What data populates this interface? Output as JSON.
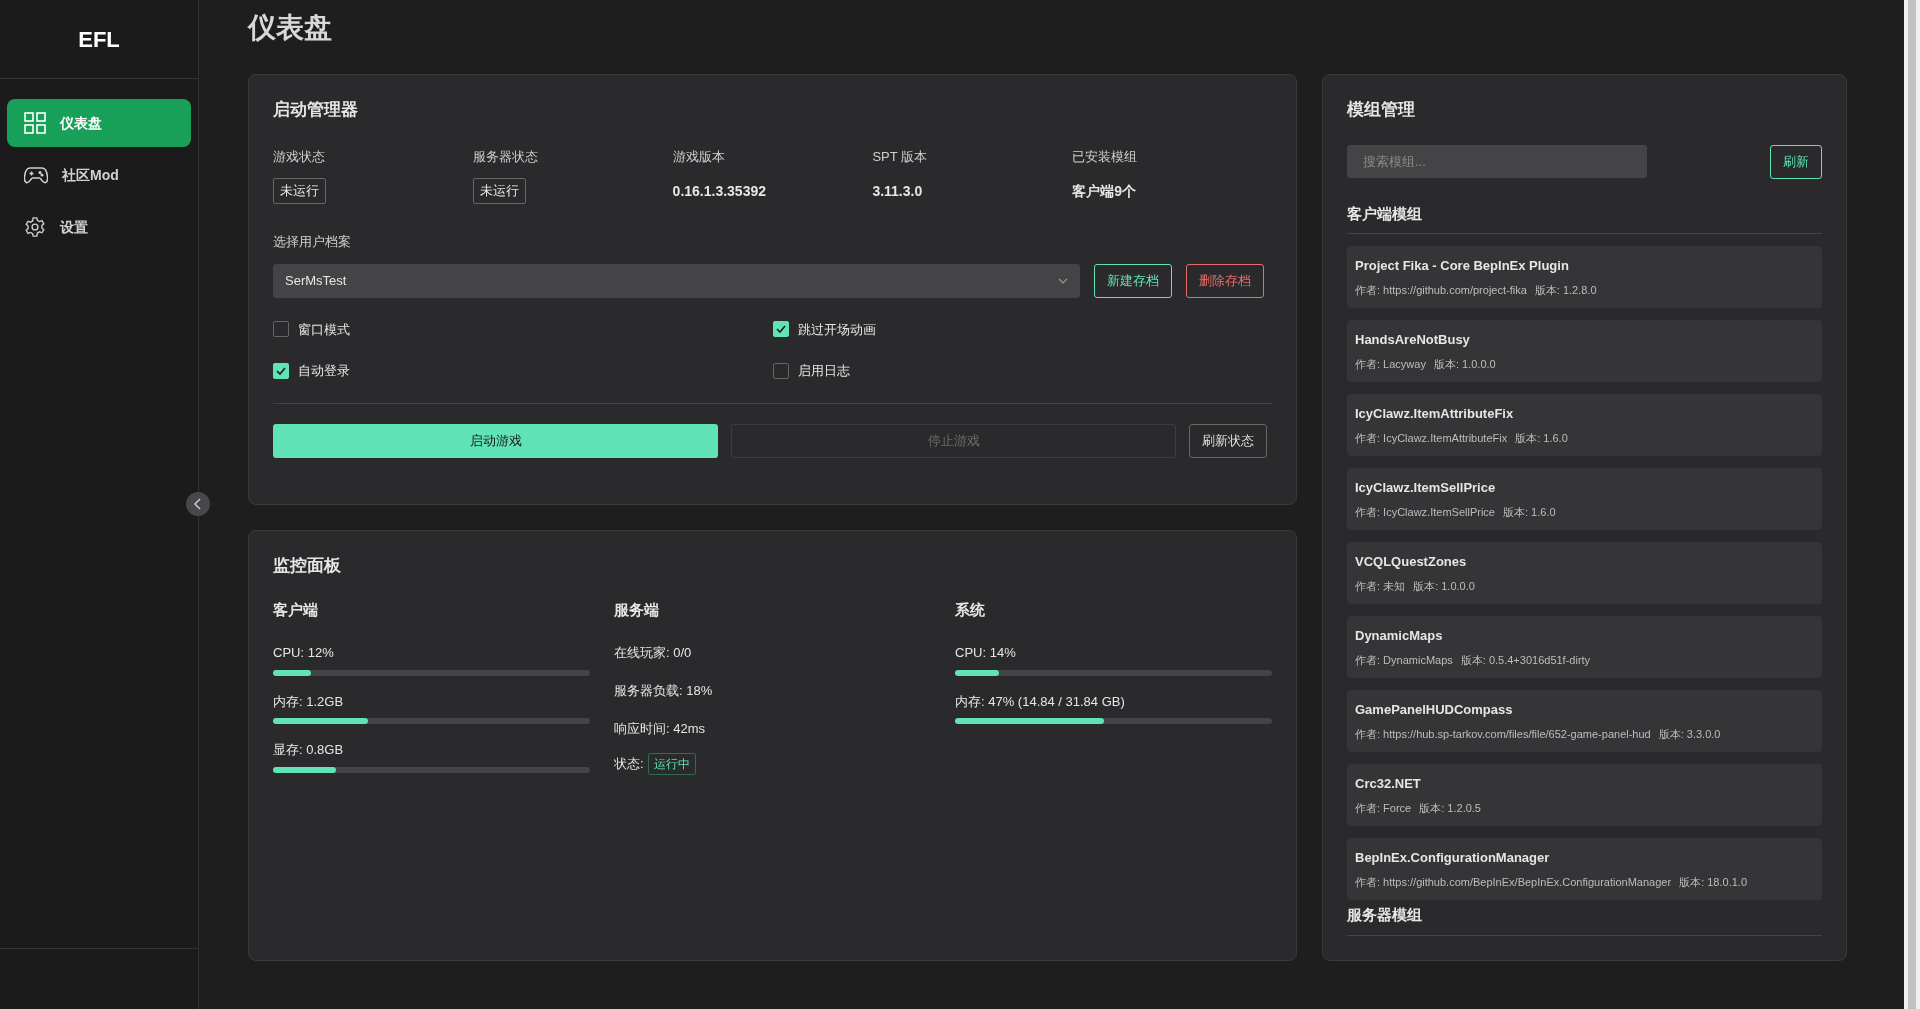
{
  "sidebar": {
    "logo": "EFL",
    "nav_items": [
      {
        "label": "仪表盘",
        "selected": true
      },
      {
        "label": "社区Mod",
        "selected": false
      },
      {
        "label": "设置",
        "selected": false
      }
    ]
  },
  "page_title": "仪表盘",
  "launcher": {
    "title": "启动管理器",
    "status": [
      {
        "label": "游戏状态",
        "value": "未运行",
        "kind": "badge"
      },
      {
        "label": "服务器状态",
        "value": "未运行",
        "kind": "badge"
      },
      {
        "label": "游戏版本",
        "value": "0.16.1.3.35392",
        "kind": "text"
      },
      {
        "label": "SPT 版本",
        "value": "3.11.3.0",
        "kind": "text"
      },
      {
        "label": "已安装模组",
        "value": "客户端9个",
        "kind": "text"
      }
    ],
    "profile": {
      "label": "选择用户档案",
      "value": "SerMsTest"
    },
    "profile_buttons": [
      {
        "label": "新建存档",
        "kind": "success"
      },
      {
        "label": "删除存档",
        "kind": "danger"
      }
    ],
    "options": [
      {
        "label": "窗口模式",
        "checked": false
      },
      {
        "label": "跳过开场动画",
        "checked": true
      },
      {
        "label": "自动登录",
        "checked": true
      },
      {
        "label": "启用日志",
        "checked": false
      }
    ],
    "actions": [
      {
        "label": "启动游戏",
        "kind": "primary",
        "disabled": false
      },
      {
        "label": "停止游戏",
        "kind": "outline",
        "disabled": true
      },
      {
        "label": "刷新状态",
        "kind": "outline",
        "disabled": false
      }
    ]
  },
  "monitor": {
    "title": "监控面板",
    "columns": [
      {
        "title": "客户端",
        "rows": [
          {
            "kind": "meter",
            "label": "CPU: 12%",
            "level": 0.12
          },
          {
            "kind": "meter",
            "label": "内存: 1.2GB",
            "level": 0.3
          },
          {
            "kind": "meter",
            "label": "显存: 0.8GB",
            "level": 0.2
          }
        ]
      },
      {
        "title": "服务端",
        "rows": [
          {
            "kind": "text",
            "label": "在线玩家: 0/0"
          },
          {
            "kind": "text",
            "label": "服务器负载: 18%"
          },
          {
            "kind": "text",
            "label": "响应时间: 42ms"
          },
          {
            "kind": "status",
            "label": "状态:",
            "badge": "运行中"
          }
        ]
      },
      {
        "title": "系统",
        "rows": [
          {
            "kind": "meter",
            "label": "CPU: 14%",
            "level": 0.14
          },
          {
            "kind": "meter",
            "label": "内存: 47% (14.84 / 31.84 GB)",
            "level": 0.47
          }
        ]
      }
    ]
  },
  "mods": {
    "title": "模组管理",
    "search": {
      "placeholder": "搜索模组..."
    },
    "refresh_button": "刷新",
    "sections": [
      {
        "title": "客户端模组",
        "mods": [
          {
            "name": "Project Fika - Core BepInEx Plugin",
            "author": "作者: https://github.com/project-fika",
            "version": "版本: 1.2.8.0"
          },
          {
            "name": "HandsAreNotBusy",
            "author": "作者: Lacyway",
            "version": "版本: 1.0.0.0"
          },
          {
            "name": "IcyClawz.ItemAttributeFix",
            "author": "作者: IcyClawz.ItemAttributeFix",
            "version": "版本: 1.6.0"
          },
          {
            "name": "IcyClawz.ItemSellPrice",
            "author": "作者: IcyClawz.ItemSellPrice",
            "version": "版本: 1.6.0"
          },
          {
            "name": "VCQLQuestZones",
            "author": "作者: 未知",
            "version": "版本: 1.0.0.0"
          },
          {
            "name": "DynamicMaps",
            "author": "作者: DynamicMaps",
            "version": "版本: 0.5.4+3016d51f-dirty"
          },
          {
            "name": "GamePanelHUDCompass",
            "author": "作者: https://hub.sp-tarkov.com/files/file/652-game-panel-hud",
            "version": "版本: 3.3.0.0"
          },
          {
            "name": "Crc32.NET",
            "author": "作者: Force",
            "version": "版本: 1.2.0.5"
          },
          {
            "name": "BepInEx.ConfigurationManager",
            "author": "作者: https://github.com/BepInEx/BepInEx.ConfigurationManager",
            "version": "版本: 18.0.1.0"
          }
        ]
      },
      {
        "title": "服务器模组"
      }
    ]
  }
}
